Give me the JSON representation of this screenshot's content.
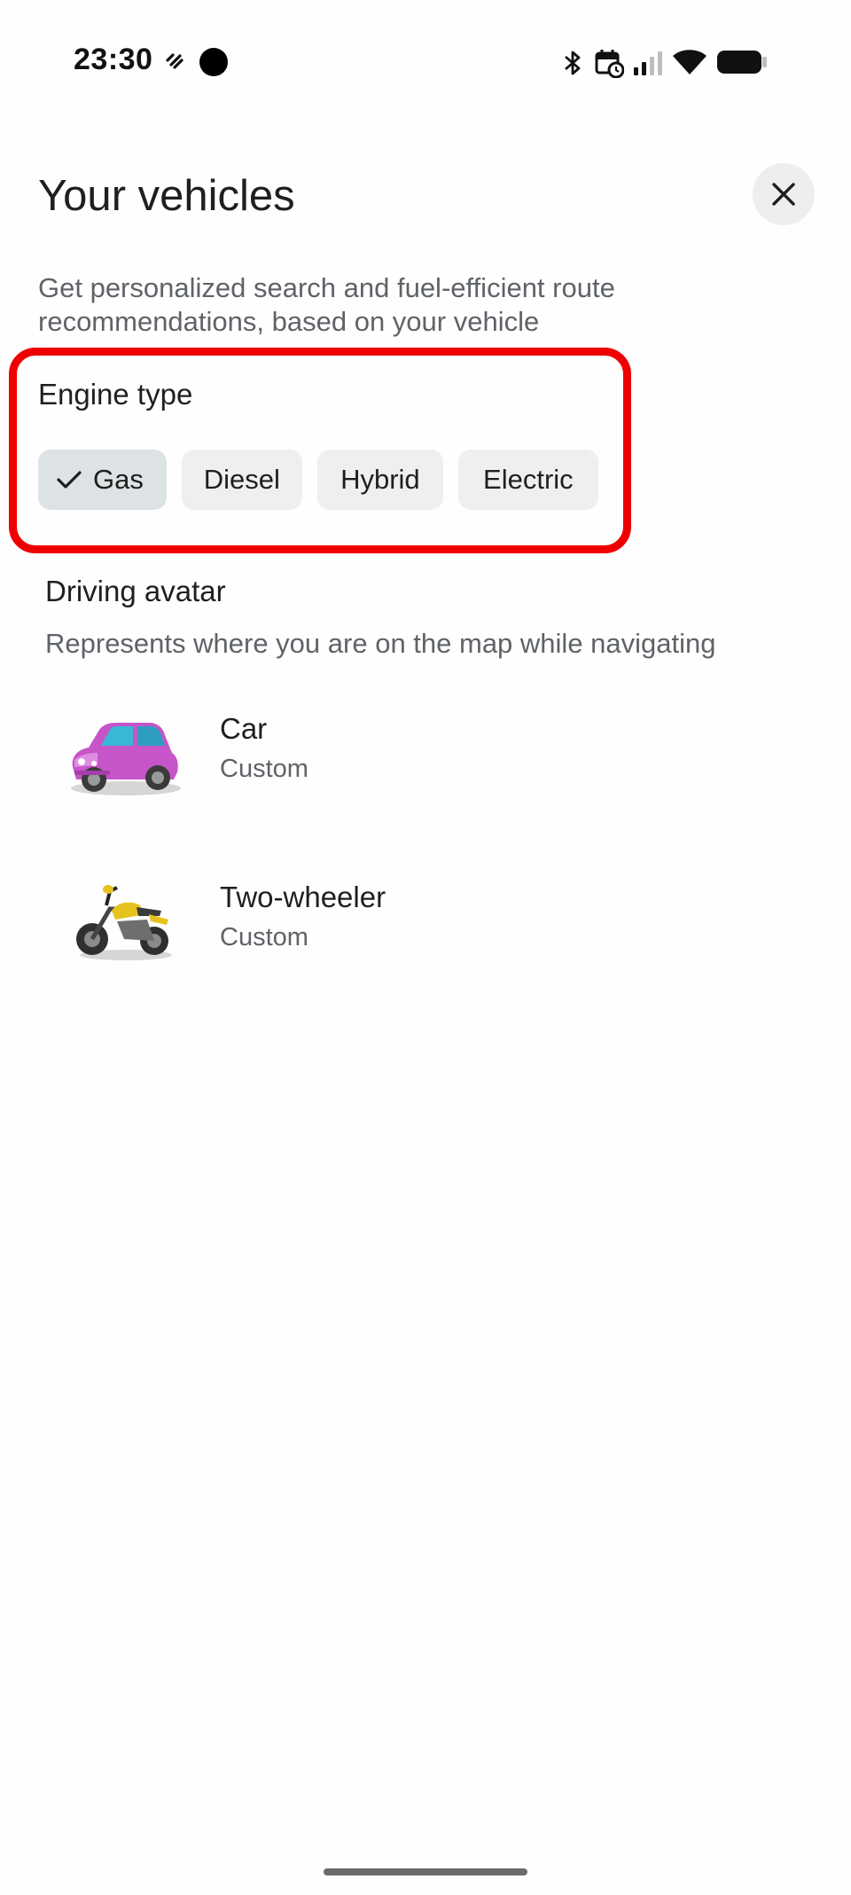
{
  "status_bar": {
    "time": "23:30",
    "icons": [
      "flash-off-icon",
      "camera-cutout-icon",
      "bluetooth-icon",
      "calendar-clock-icon",
      "signal-icon",
      "wifi-icon",
      "battery-icon"
    ]
  },
  "header": {
    "title": "Your vehicles",
    "close_icon": "close-icon"
  },
  "intro": {
    "description": "Get personalized search and fuel-efficient route recommendations, based on your vehicle"
  },
  "engine_type": {
    "label": "Engine type",
    "options": [
      {
        "label": "Gas",
        "selected": true
      },
      {
        "label": "Diesel",
        "selected": false
      },
      {
        "label": "Hybrid",
        "selected": false
      },
      {
        "label": "Electric",
        "selected": false
      }
    ]
  },
  "driving_avatar": {
    "label": "Driving avatar",
    "description": "Represents where you are on the map while navigating",
    "items": [
      {
        "title": "Car",
        "subtitle": "Custom",
        "icon": "pink-car-icon"
      },
      {
        "title": "Two-wheeler",
        "subtitle": "Custom",
        "icon": "yellow-motorcycle-icon"
      }
    ]
  },
  "colors": {
    "highlight": "#ef0000",
    "chip_background": "#efefef",
    "chip_selected_background": "#dde3e4",
    "secondary_text": "#5f6368",
    "car_body": "#c655c9",
    "motorcycle_body": "#e6c21e"
  }
}
